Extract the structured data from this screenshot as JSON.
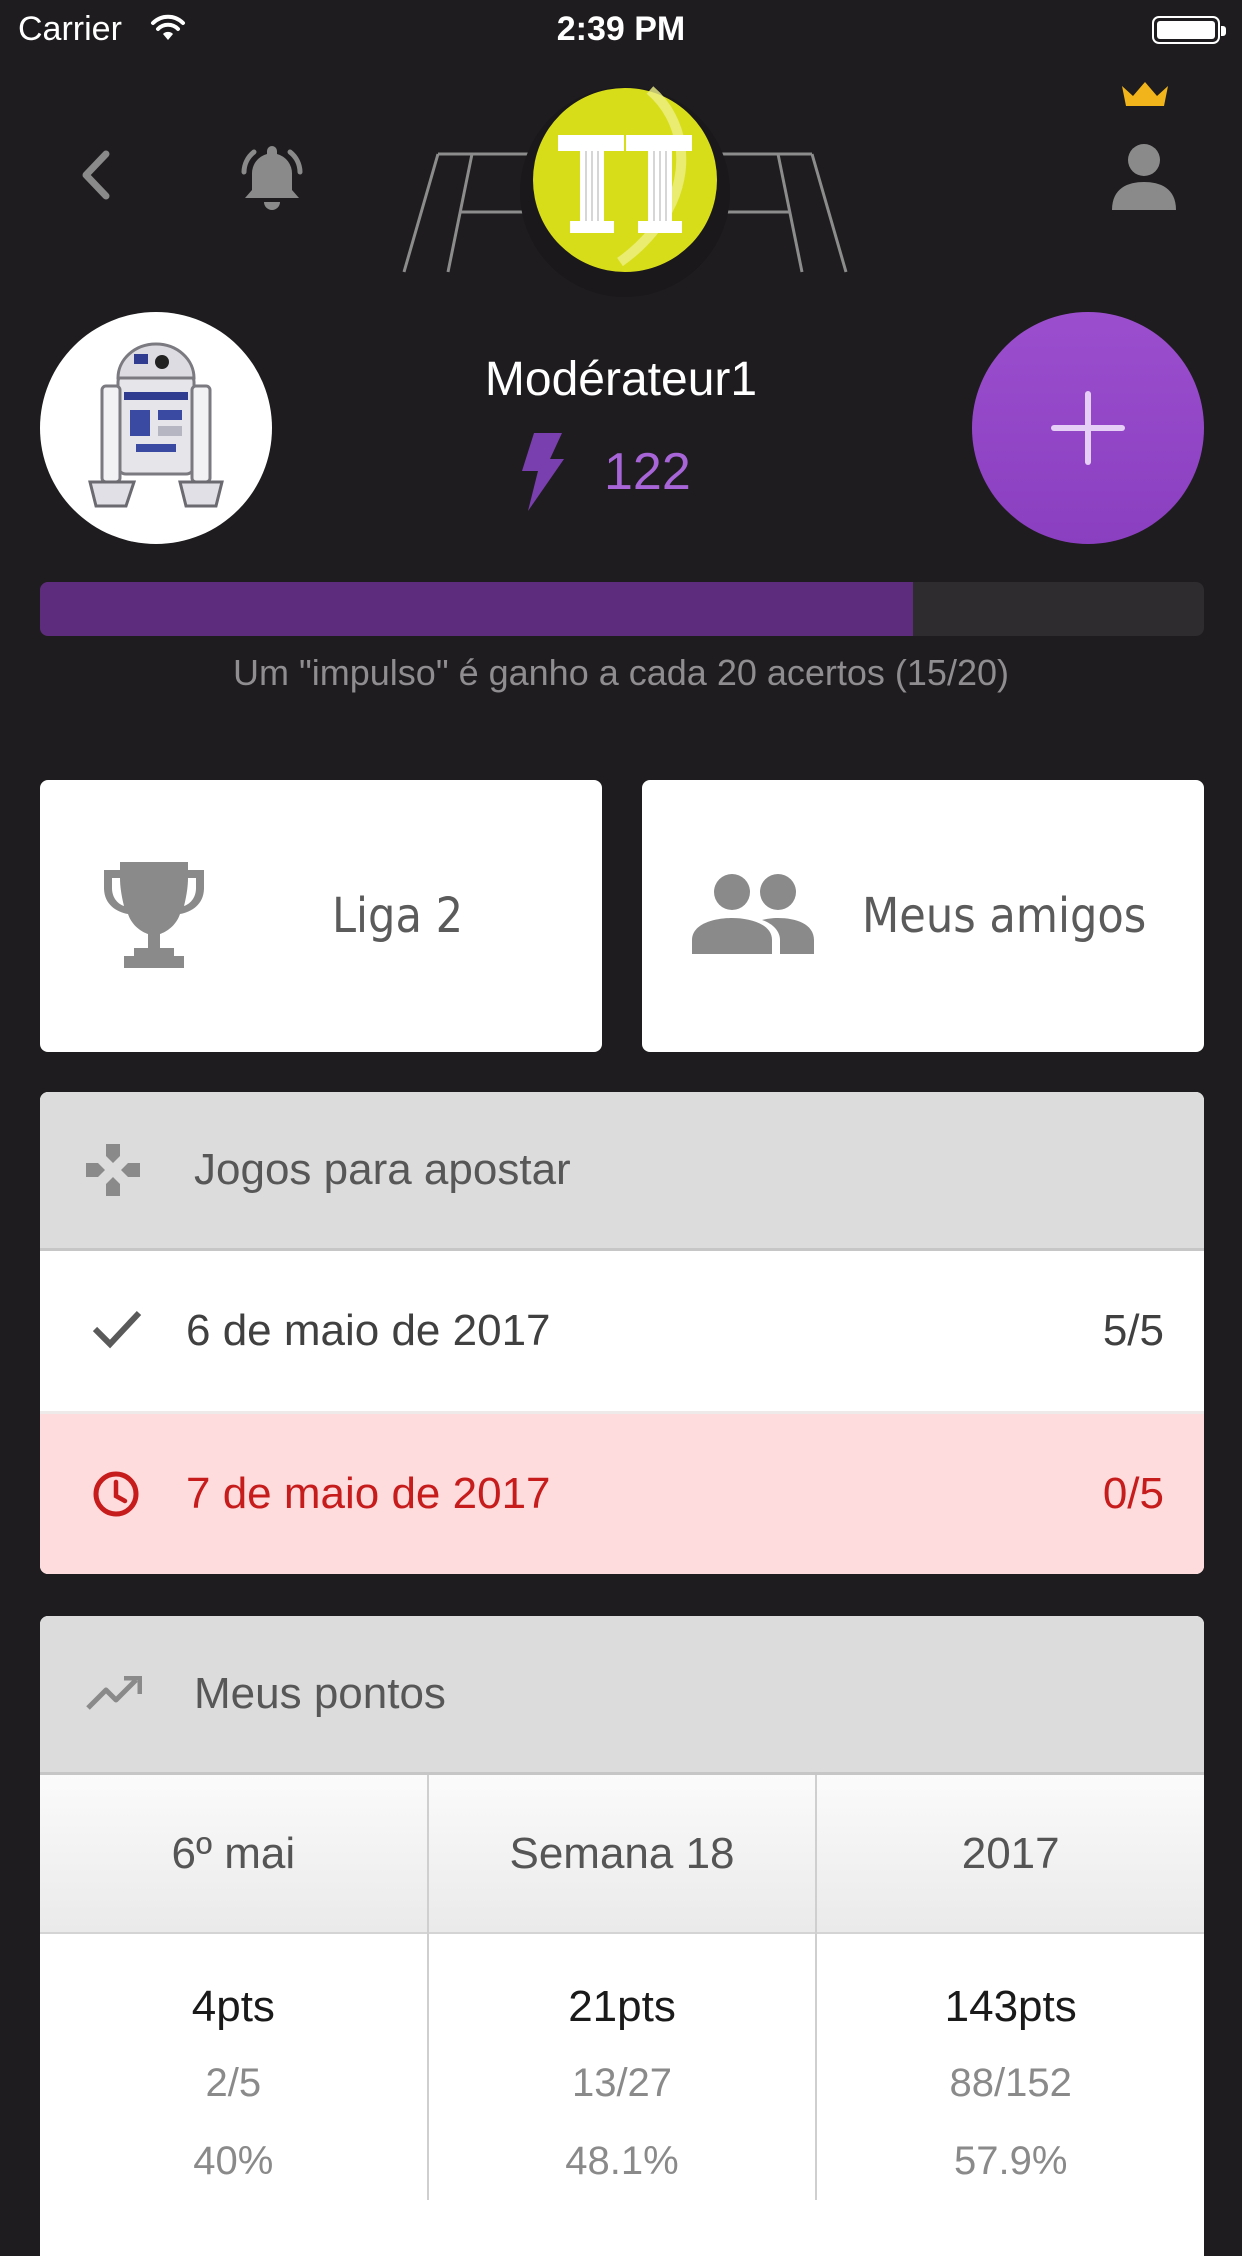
{
  "status_bar": {
    "carrier": "Carrier",
    "time": "2:39 PM"
  },
  "header": {
    "logo_text": "TT"
  },
  "user": {
    "name": "Modérateur1",
    "boost_count": "122"
  },
  "progress": {
    "current": 15,
    "total": 20,
    "fraction": 0.75,
    "text": "Um \"impulso\" é ganho a cada 20 acertos (15/20)"
  },
  "tiles": {
    "league_label": "Liga 2",
    "friends_label": "Meus amigos"
  },
  "games": {
    "title": "Jogos para apostar",
    "rows": [
      {
        "date": "6 de maio de 2017",
        "score": "5/5",
        "state": "done"
      },
      {
        "date": "7 de maio de 2017",
        "score": "0/5",
        "state": "pending"
      }
    ]
  },
  "points": {
    "title": "Meus pontos",
    "columns": [
      {
        "label": "6º mai",
        "pts": "4pts",
        "ratio": "2/5",
        "percent": "40%"
      },
      {
        "label": "Semana 18",
        "pts": "21pts",
        "ratio": "13/27",
        "percent": "48.1%"
      },
      {
        "label": "2017",
        "pts": "143pts",
        "ratio": "88/152",
        "percent": "57.9%"
      }
    ]
  },
  "colors": {
    "background": "#1e1c1e",
    "accent_purple": "#9b4fcf",
    "progress_fill": "#5e2c7d",
    "pending_bg": "#fedcdd",
    "pending_text": "#c71c1c",
    "crown": "#f1b51b",
    "logo_ball": "#d8dd1a"
  },
  "icons": {
    "back": "chevron-left-icon",
    "notifications": "bell-icon",
    "profile": "person-icon",
    "premium": "crown-icon",
    "boost": "lightning-icon",
    "add": "plus-icon",
    "league": "trophy-icon",
    "friends": "group-icon",
    "games": "gamepad-icon",
    "done": "check-icon",
    "pending": "clock-icon",
    "points": "trending-up-icon"
  }
}
